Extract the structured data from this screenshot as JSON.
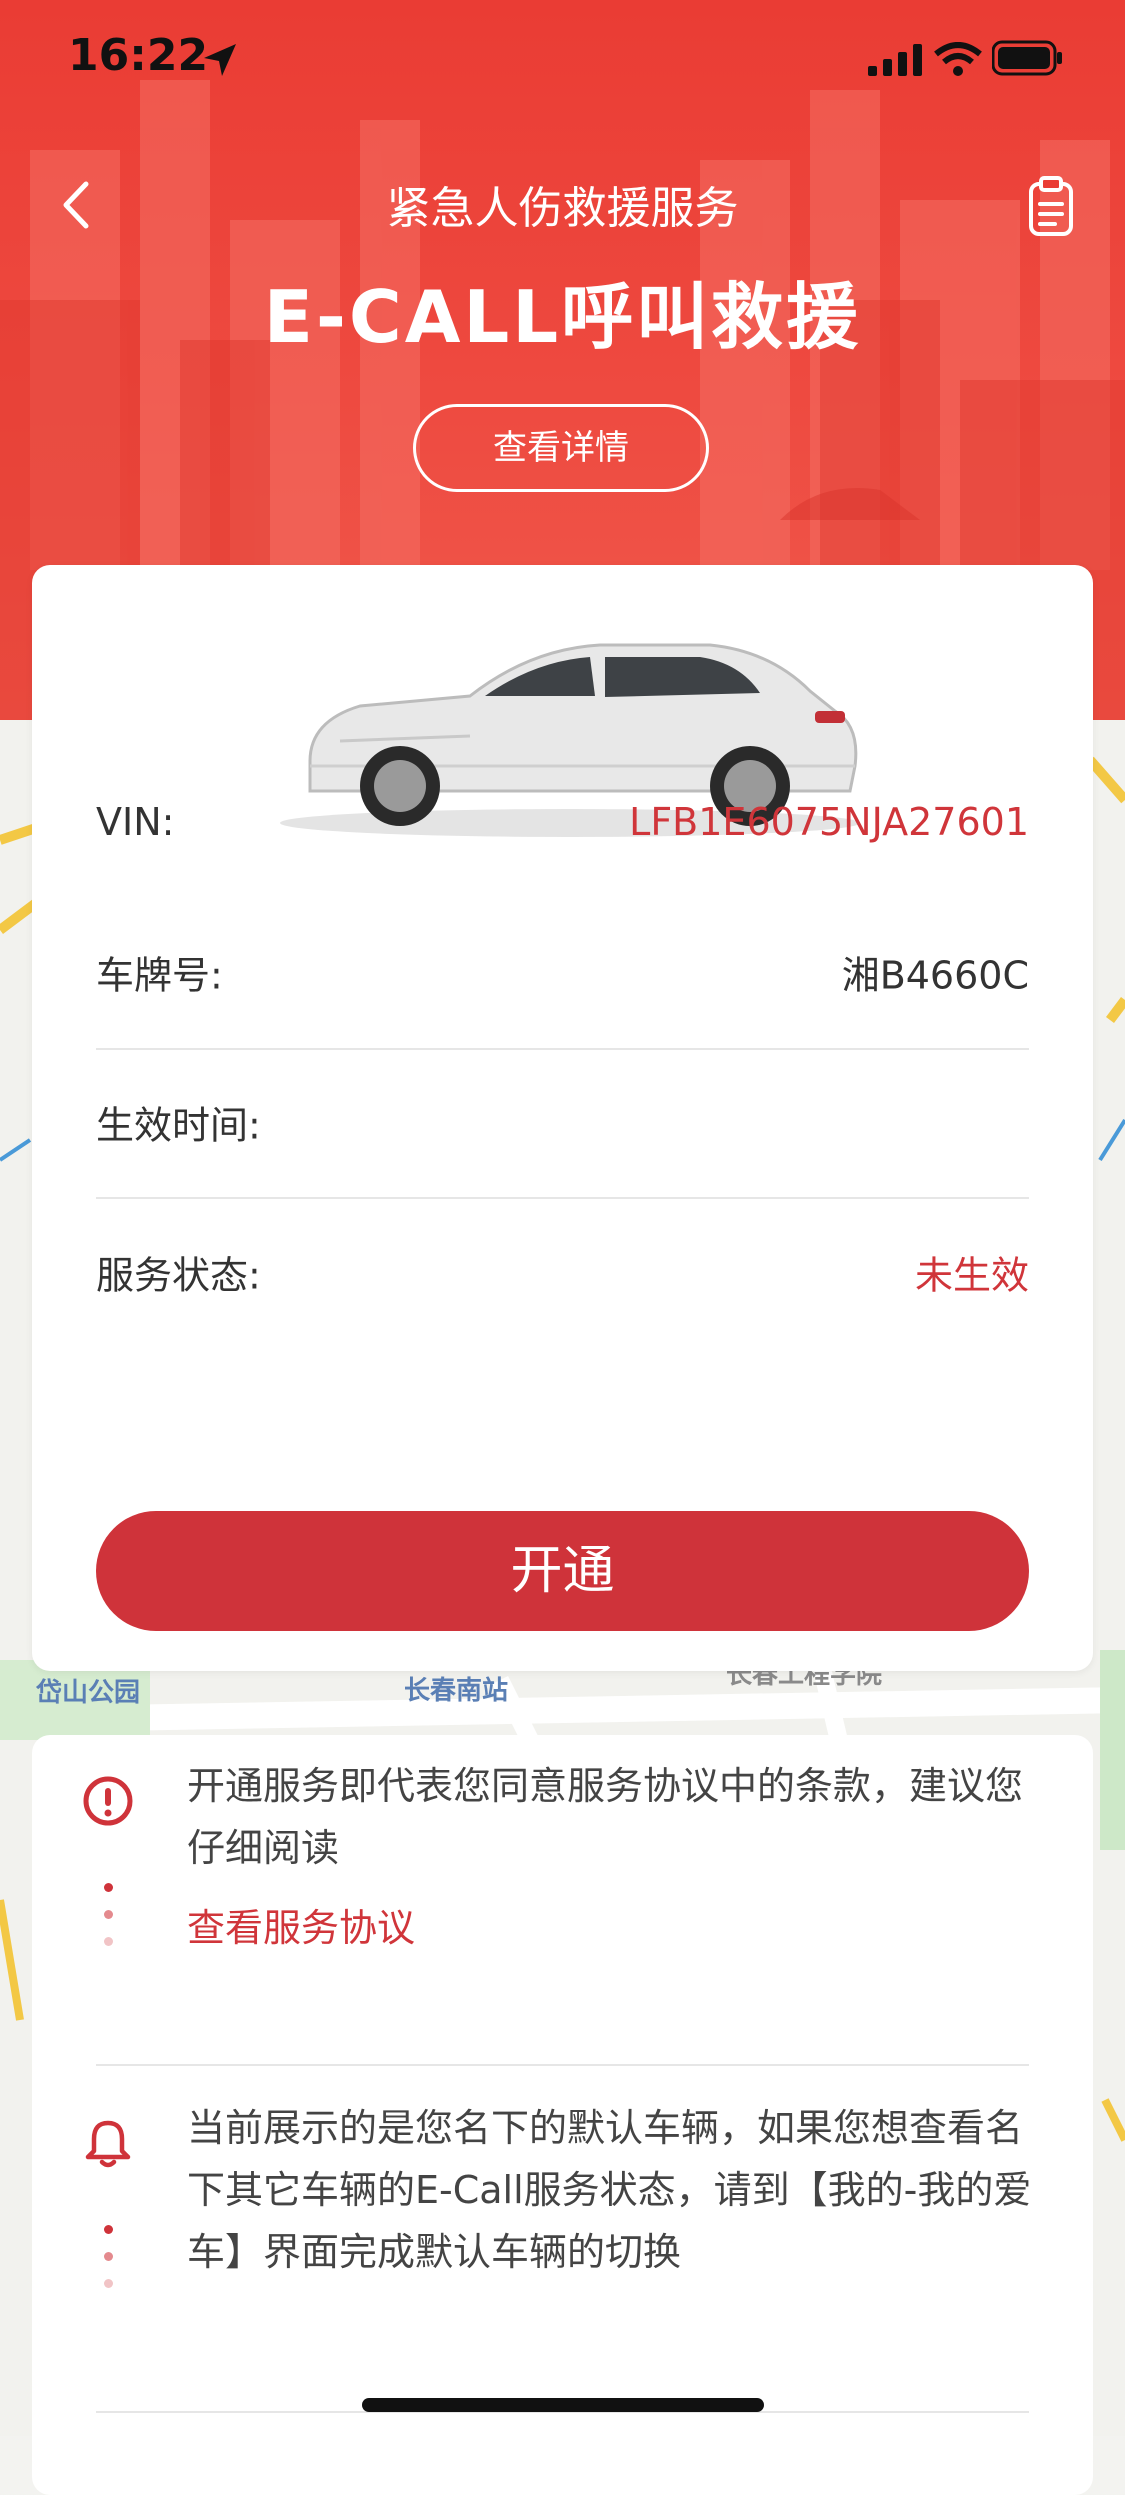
{
  "status_bar": {
    "time": "16:22"
  },
  "header": {
    "nav_title": "紧急人伤救援服务",
    "hero_title": "E-CALL呼叫救援",
    "detail_button": "查看详情"
  },
  "vehicle": {
    "rows": [
      {
        "label": "VIN:",
        "value": "LFB1E6075NJA27601"
      },
      {
        "label": "车牌号:",
        "value": "湘B4660C"
      },
      {
        "label": "生效时间:",
        "value": ""
      },
      {
        "label": "服务状态:",
        "value": "未生效"
      }
    ],
    "open_button": "开通"
  },
  "map_labels": [
    "岱山公园",
    "长春南站",
    "长春工程学院"
  ],
  "notices": {
    "agreement_text": "开通服务即代表您同意服务协议中的条款，建议您仔细阅读",
    "agreement_link": "查看服务协议",
    "default_vehicle_text": "当前展示的是您名下的默认车辆，如果您想查看名下其它车辆的E-Call服务状态，请到【我的-我的爱车】界面完成默认车辆的切换"
  },
  "colors": {
    "brand_red": "#cf333a",
    "header_red": "#ea3c34",
    "value_red": "#d0353a"
  },
  "icons": [
    "back-arrow-icon",
    "clipboard-icon",
    "location-arrow-icon",
    "signal-icon",
    "wifi-icon",
    "battery-icon",
    "alert-circle-icon",
    "bell-icon"
  ]
}
